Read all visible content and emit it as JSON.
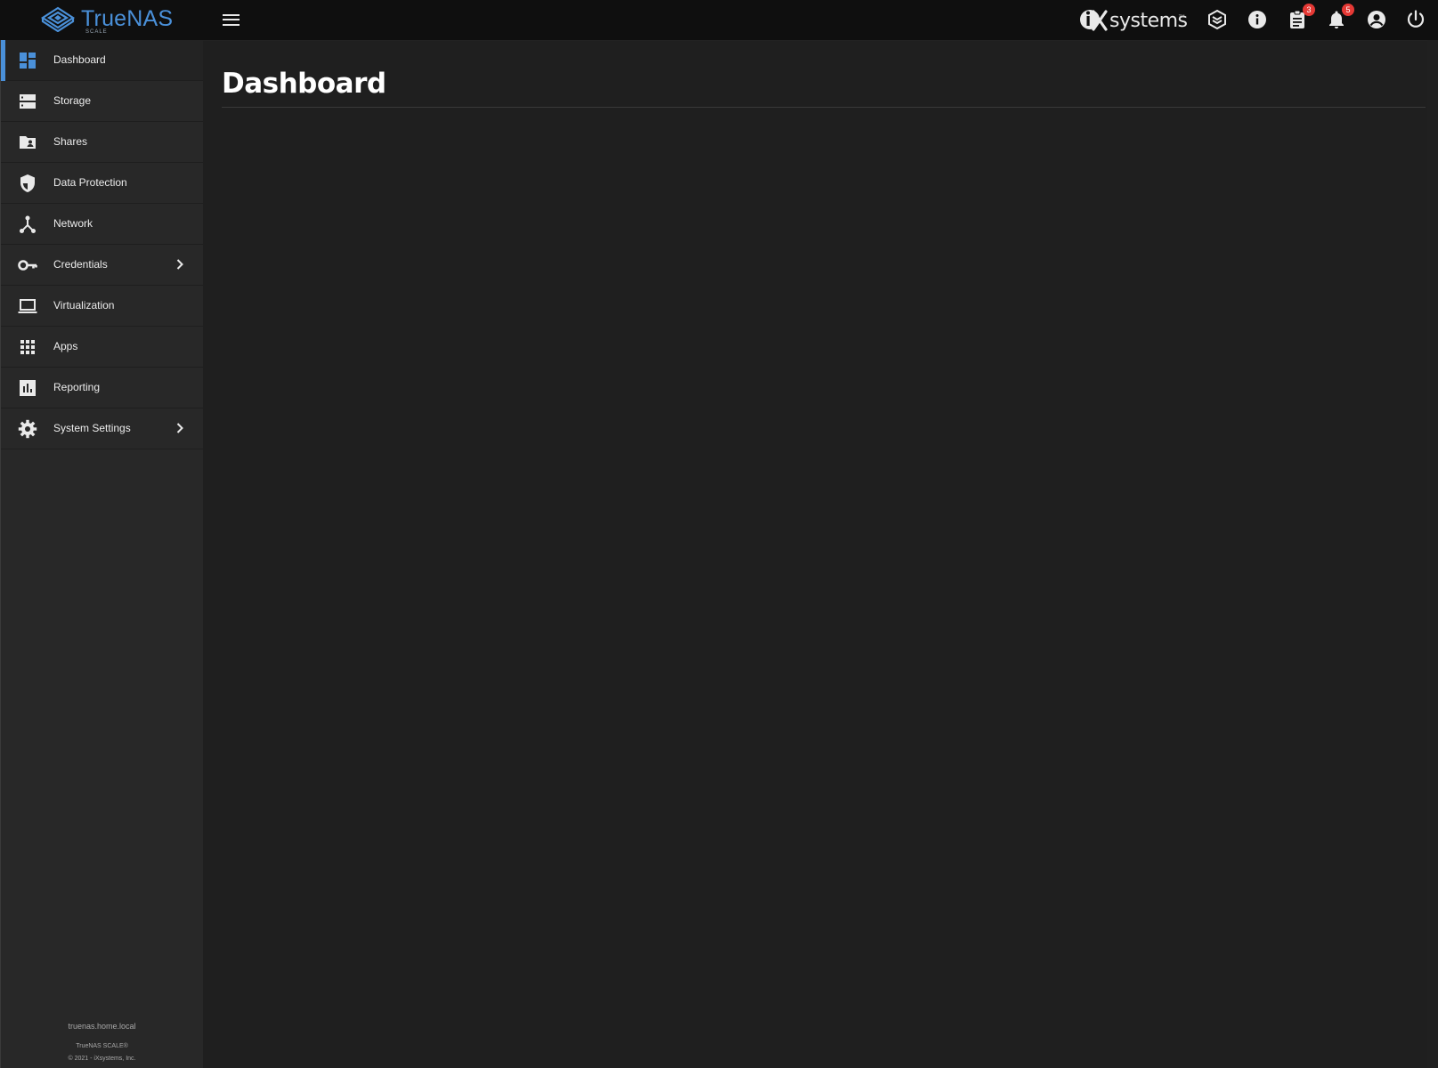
{
  "brand": {
    "logo_text": "TrueNAS",
    "logo_sub": "SCALE",
    "vendor_text": "systems",
    "vendor_mark": "iX",
    "vendor_tm": "™",
    "accent_color": "#4a90d9",
    "badge_color": "#e53935"
  },
  "topbar": {
    "icons": [
      {
        "name": "truecommand-icon"
      },
      {
        "name": "help-info-icon"
      },
      {
        "name": "tasks-clipboard-icon",
        "badge": "3"
      },
      {
        "name": "alerts-bell-icon",
        "badge": "5"
      },
      {
        "name": "account-circle-icon"
      },
      {
        "name": "power-icon"
      }
    ]
  },
  "sidebar": {
    "items": [
      {
        "label": "Dashboard",
        "icon": "dashboard-icon",
        "active": true
      },
      {
        "label": "Storage",
        "icon": "storage-icon"
      },
      {
        "label": "Shares",
        "icon": "folder-shared-icon"
      },
      {
        "label": "Data Protection",
        "icon": "security-shield-icon"
      },
      {
        "label": "Network",
        "icon": "network-icon"
      },
      {
        "label": "Credentials",
        "icon": "key-icon",
        "has_children": true
      },
      {
        "label": "Virtualization",
        "icon": "laptop-icon"
      },
      {
        "label": "Apps",
        "icon": "apps-grid-icon"
      },
      {
        "label": "Reporting",
        "icon": "insert-chart-icon"
      },
      {
        "label": "System Settings",
        "icon": "gear-icon",
        "has_children": true
      }
    ],
    "footer": {
      "hostname": "truenas.home.local",
      "version": "TrueNAS SCALE®",
      "copyright": "© 2021 - iXsystems, Inc."
    }
  },
  "main": {
    "title": "Dashboard"
  }
}
